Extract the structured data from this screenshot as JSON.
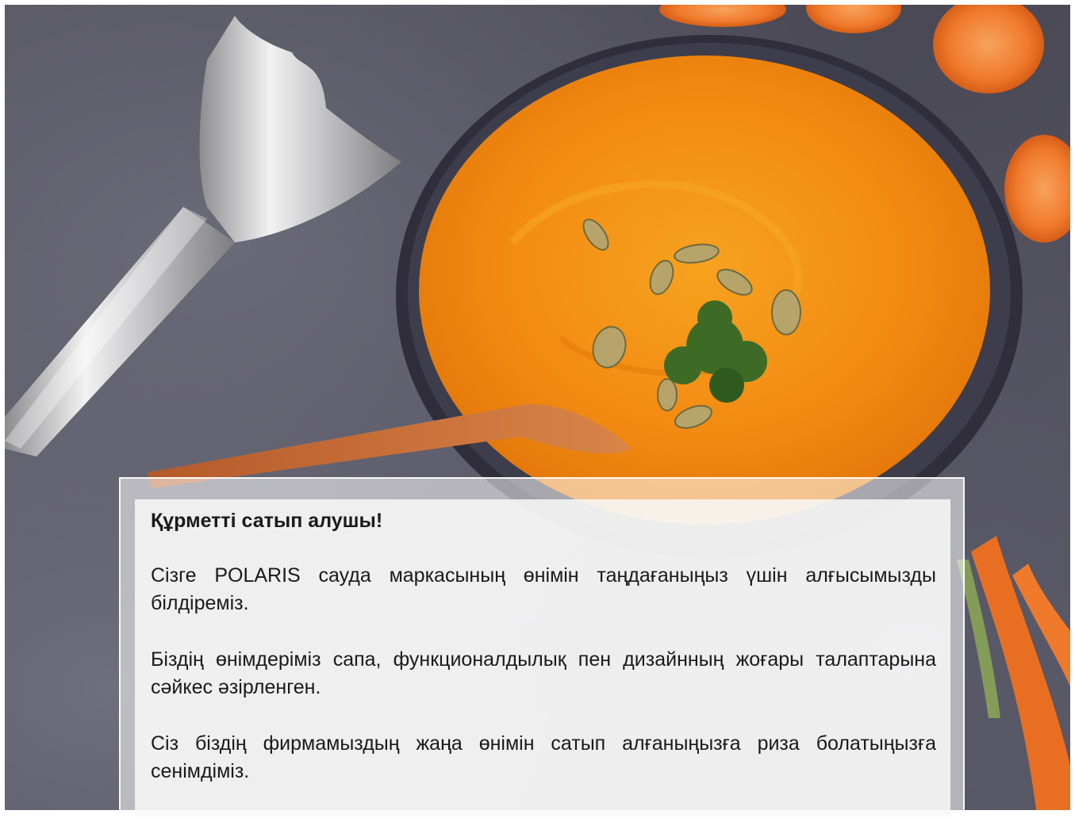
{
  "document": {
    "greeting": "Құрметті сатып алушы!",
    "paragraphs": [
      "Сізге POLARIS сауда маркасының өнімін таңдағаныңыз үшін алғысымызды білдіреміз.",
      "Біздің өнімдеріміз сапа, функционалдылық пен дизайнның жоғары талаптарына сәйкес әзірленген.",
      "Сіз біздің фирмамыздың жаңа өнімін сатып алғаныңызға риза болатыңызға сенімдіміз."
    ]
  },
  "colors": {
    "soup": "#f28a12",
    "bowl": "#3a3946",
    "carrot": "#f07a2c",
    "table": "#4e4d59"
  },
  "illustration": {
    "items": [
      "blender-attachment",
      "soup-bowl",
      "wooden-spoon",
      "pumpkin-seeds",
      "parsley-garnish",
      "carrot-slices",
      "carrots"
    ]
  }
}
